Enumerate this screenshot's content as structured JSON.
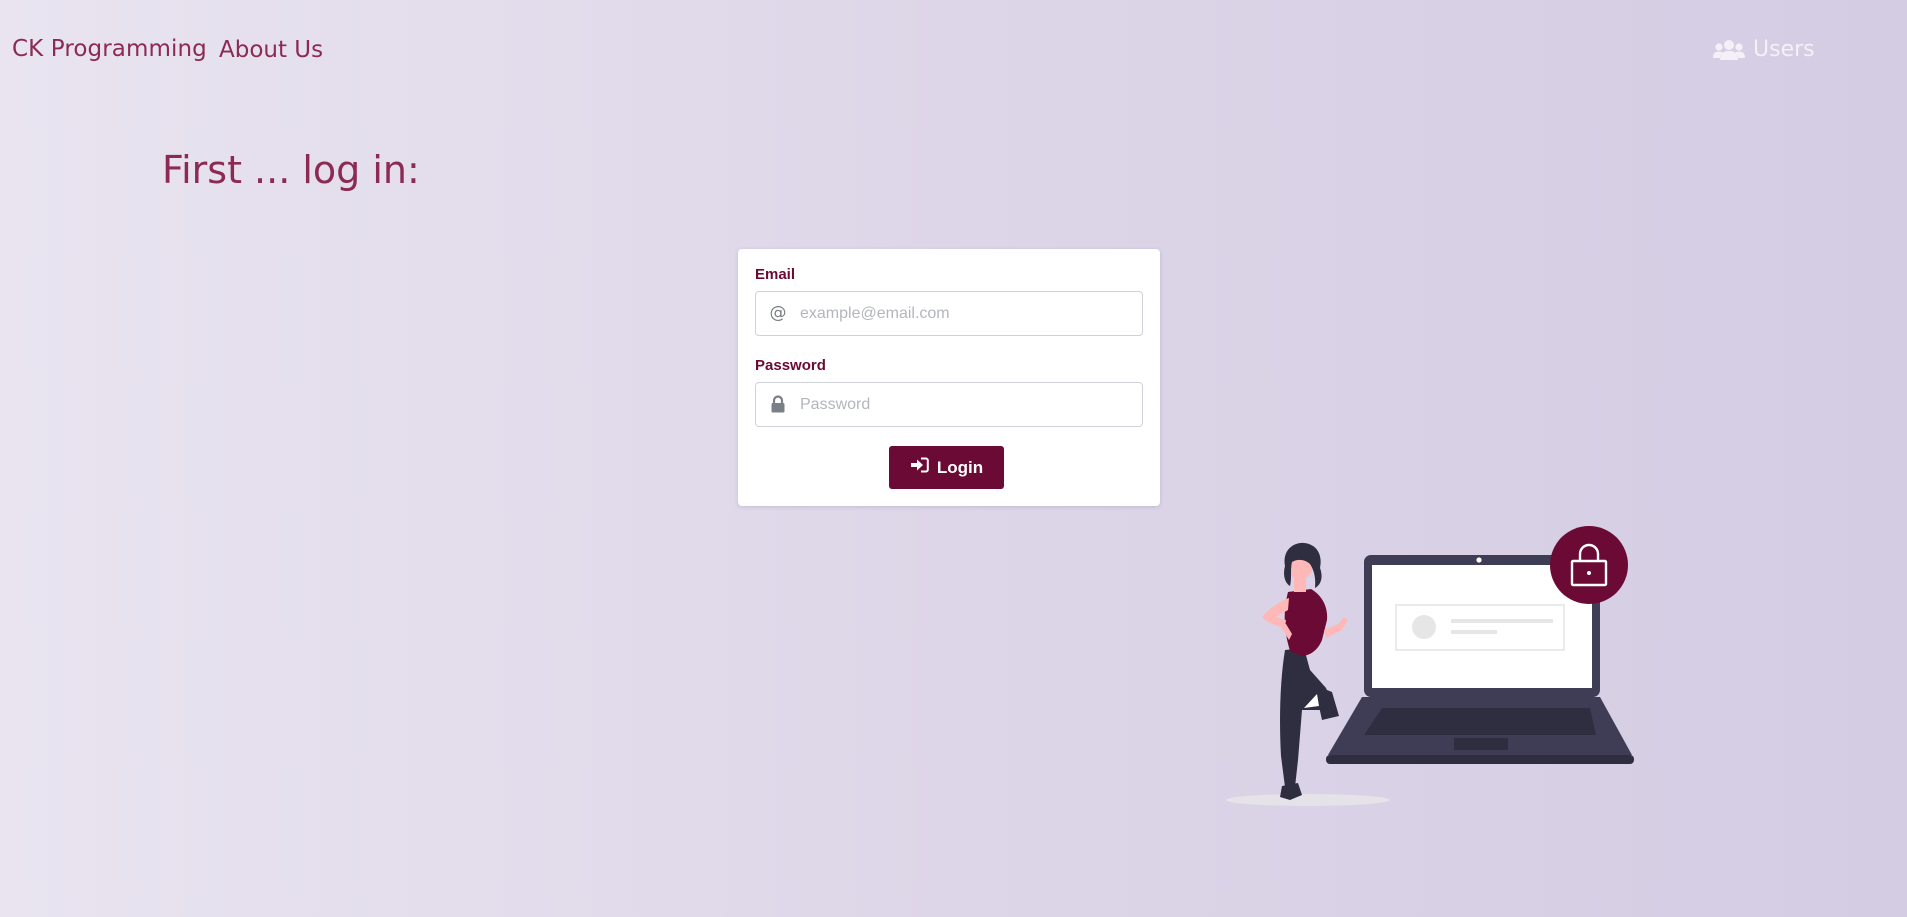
{
  "navbar": {
    "brand": "CK Programming",
    "about": "About Us",
    "users": "Users"
  },
  "page": {
    "title": "First ... log in:"
  },
  "login_form": {
    "email_label": "Email",
    "email_placeholder": "example@email.com",
    "email_value": "",
    "password_label": "Password",
    "password_placeholder": "Password",
    "password_value": "",
    "submit_label": "Login"
  },
  "icons": {
    "users": "users-icon",
    "email": "at-sign-icon",
    "password": "lock-icon",
    "login": "sign-in-icon"
  },
  "colors": {
    "brand": "#8c2a54",
    "primary": "#6b0a35",
    "background_start": "#e9e4f0",
    "background_end": "#d4cce3"
  }
}
